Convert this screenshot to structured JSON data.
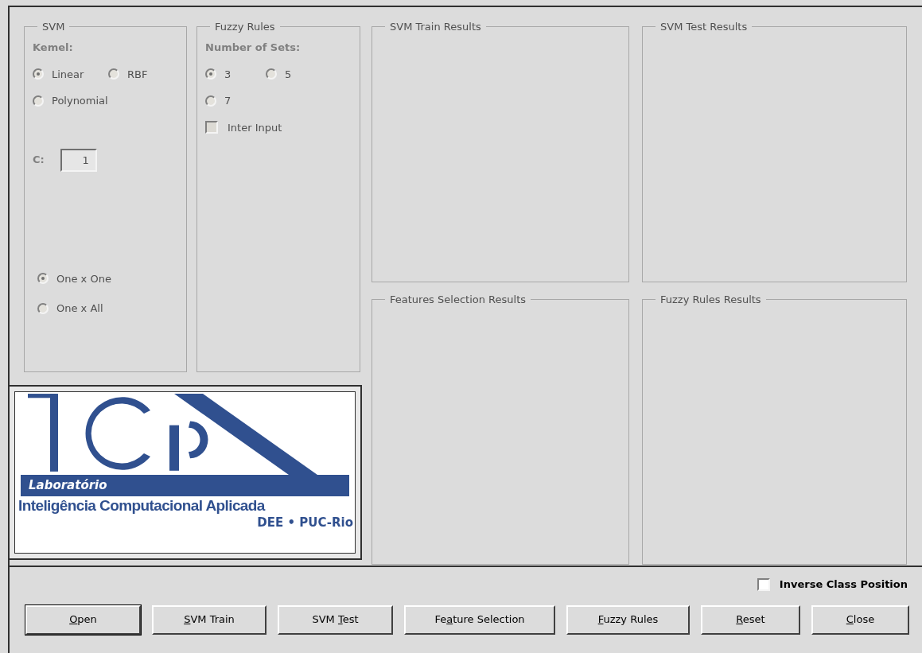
{
  "svm": {
    "title": "SVM",
    "kernel_label": "Kemel:",
    "kernels": [
      {
        "label": "Linear",
        "selected": true
      },
      {
        "label": "RBF",
        "selected": false
      },
      {
        "label": "Polynomial",
        "selected": false
      }
    ],
    "c_label": "C:",
    "c_value": "1",
    "strategies": [
      {
        "label": "One x One",
        "selected": true
      },
      {
        "label": "One x All",
        "selected": false
      }
    ]
  },
  "fuzzy": {
    "title": "Fuzzy Rules",
    "sets_label": "Number of Sets:",
    "sets": [
      {
        "label": "3",
        "selected": true
      },
      {
        "label": "5",
        "selected": false
      },
      {
        "label": "7",
        "selected": false
      }
    ],
    "inter_input": {
      "label": "Inter Input",
      "checked": false
    }
  },
  "results": [
    {
      "title": "SVM Train Results"
    },
    {
      "title": "SVM Test Results"
    },
    {
      "title": "Features Selection Results"
    },
    {
      "title": "Fuzzy Rules Results"
    }
  ],
  "logo": {
    "lab": "Laboratório",
    "name": "Inteligência Computacional Aplicada",
    "dept": "DEE • PUC-Rio"
  },
  "inverse_class": {
    "label": "Inverse Class Position",
    "checked": false
  },
  "buttons": [
    {
      "label": [
        {
          "text": "O",
          "underline": true
        },
        {
          "text": "pen",
          "underline": false
        }
      ],
      "default": true
    },
    {
      "label": [
        {
          "text": "S",
          "underline": true
        },
        {
          "text": "VM Train",
          "underline": false
        }
      ],
      "default": false
    },
    {
      "label": [
        {
          "text": "SVM ",
          "underline": false
        },
        {
          "text": "T",
          "underline": true
        },
        {
          "text": "est",
          "underline": false
        }
      ],
      "default": false
    },
    {
      "label": [
        {
          "text": "Fe",
          "underline": false
        },
        {
          "text": "a",
          "underline": true
        },
        {
          "text": "ture Selection",
          "underline": false
        }
      ],
      "default": false
    },
    {
      "label": [
        {
          "text": "F",
          "underline": true
        },
        {
          "text": "uzzy Rules",
          "underline": false
        }
      ],
      "default": false
    },
    {
      "label": [
        {
          "text": "R",
          "underline": true
        },
        {
          "text": "eset",
          "underline": false
        }
      ],
      "default": false
    },
    {
      "label": [
        {
          "text": "C",
          "underline": true
        },
        {
          "text": "lose",
          "underline": false
        }
      ],
      "default": false
    }
  ]
}
